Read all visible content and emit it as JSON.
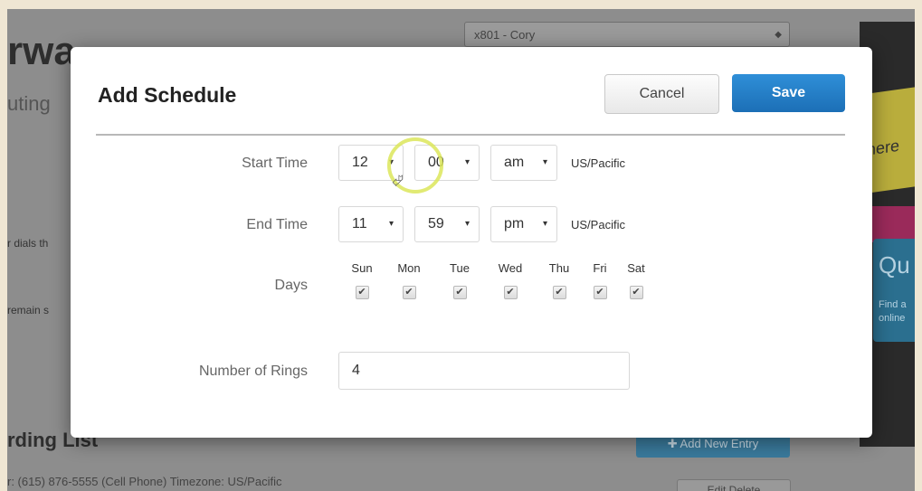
{
  "background": {
    "page_title": "rwa",
    "page_subtitle": "uting",
    "selector_value": "x801 - Cory",
    "text_1": "r dials th",
    "text_2": "remain s",
    "section_heading": "rding List",
    "add_button": "Add New Entry",
    "row_text": "r: (615) 876-5555 (Cell Phone)  Timezone: US/Pacific",
    "row_actions": "Edit     Delete",
    "side_banner_text": "here",
    "side_box_title": "Qu",
    "side_box_text": "Find a online"
  },
  "modal": {
    "title": "Add Schedule",
    "cancel_label": "Cancel",
    "save_label": "Save",
    "start_time": {
      "label": "Start Time",
      "hour": "12",
      "minute": "00",
      "ampm": "am",
      "timezone": "US/Pacific"
    },
    "end_time": {
      "label": "End Time",
      "hour": "11",
      "minute": "59",
      "ampm": "pm",
      "timezone": "US/Pacific"
    },
    "days": {
      "label": "Days",
      "items": [
        {
          "name": "Sun",
          "checked": true
        },
        {
          "name": "Mon",
          "checked": true
        },
        {
          "name": "Tue",
          "checked": true
        },
        {
          "name": "Wed",
          "checked": true
        },
        {
          "name": "Thu",
          "checked": true
        },
        {
          "name": "Fri",
          "checked": true
        },
        {
          "name": "Sat",
          "checked": true
        }
      ]
    },
    "rings": {
      "label": "Number of Rings",
      "value": "4"
    }
  },
  "icons": {
    "caret": "▾",
    "check": "✔",
    "plus": "✚"
  },
  "colors": {
    "save_button": "#1c6fb6",
    "overlay": "#8d8d8d",
    "cursor_highlight": "#dce65a"
  }
}
